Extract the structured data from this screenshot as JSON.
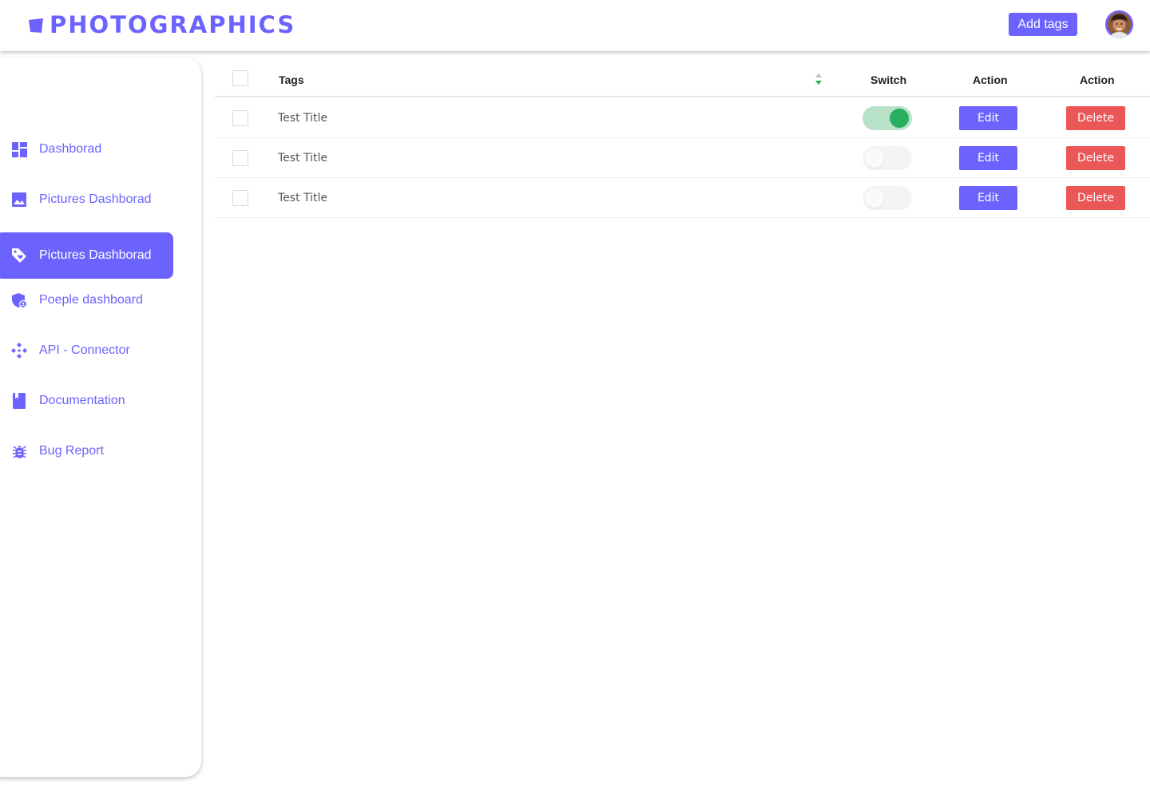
{
  "header": {
    "brand": "PHOTOGRAPHICS",
    "add_tags_label": "Add tags",
    "avatar_icon": "user-avatar"
  },
  "sidebar": {
    "items": [
      {
        "label": "Dashborad",
        "icon": "dashboard-icon",
        "active": false
      },
      {
        "label": "Pictures Dashborad",
        "icon": "image-icon",
        "active": false
      },
      {
        "label": "Pictures Dashborad",
        "icon": "tag-icon",
        "active": true
      },
      {
        "label": "Poeple dashboard",
        "icon": "shield-user-icon",
        "active": false
      },
      {
        "label": "API - Connector",
        "icon": "connector-icon",
        "active": false
      },
      {
        "label": "Documentation",
        "icon": "book-icon",
        "active": false
      },
      {
        "label": "Bug Report",
        "icon": "bug-icon",
        "active": false
      }
    ]
  },
  "table": {
    "columns": {
      "tags": "Tags",
      "switch": "Switch",
      "action_edit": "Action",
      "action_delete": "Action"
    },
    "rows": [
      {
        "title": "Test Title",
        "switch_on": true,
        "edit_label": "Edit",
        "delete_label": "Delete"
      },
      {
        "title": "Test Title",
        "switch_on": false,
        "edit_label": "Edit",
        "delete_label": "Delete"
      },
      {
        "title": "Test Title",
        "switch_on": false,
        "edit_label": "Edit",
        "delete_label": "Delete"
      }
    ]
  },
  "colors": {
    "accent": "#6C63FF",
    "danger": "#EB5757",
    "switch_on_track": "#B8E2C8",
    "switch_on_knob": "#27AE60",
    "sort_active": "#27AE60"
  }
}
